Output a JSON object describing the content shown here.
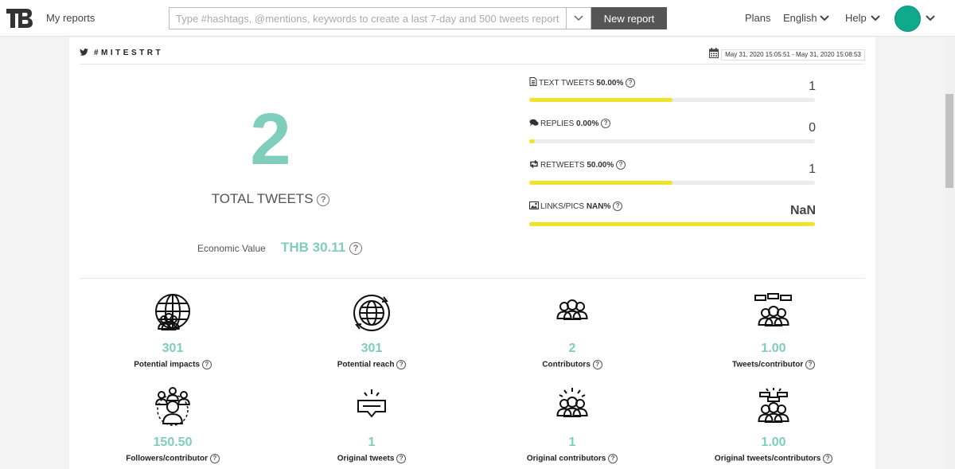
{
  "nav": {
    "my_reports": "My reports",
    "search_placeholder": "Type #hashtags, @mentions, keywords to create a last 7-day and 500 tweets report",
    "new_report": "New report",
    "plans": "Plans",
    "language": "English",
    "help": "Help"
  },
  "report": {
    "hashtag": "#MITESTRT",
    "date_range": "May 31, 2020 15:05:51 - May 31, 2020 15:08:53",
    "total_tweets": "2",
    "total_label": "TOTAL TWEETS",
    "economic_label": "Economic Value",
    "economic_value": "THB 30.11"
  },
  "metrics": [
    {
      "label": "TEXT TWEETS",
      "pct": "50.00%",
      "value": "1",
      "fill": 0.5,
      "icon": "document-icon"
    },
    {
      "label": "REPLIES",
      "pct": "0.00%",
      "value": "0",
      "fill": 0.02,
      "icon": "chat-bubble-icon"
    },
    {
      "label": "RETWEETS",
      "pct": "50.00%",
      "value": "1",
      "fill": 0.5,
      "icon": "retweet-icon"
    },
    {
      "label": "LINKS/PICS",
      "pct": "NAN%",
      "value": "NaN",
      "fill": 1.0,
      "icon": "image-icon"
    }
  ],
  "stats": [
    {
      "value": "301",
      "label": "Potential impacts",
      "icon": "globe-people-icon"
    },
    {
      "value": "301",
      "label": "Potential reach",
      "icon": "globe-reach-icon"
    },
    {
      "value": "2",
      "label": "Contributors",
      "icon": "group-icon"
    },
    {
      "value": "1.00",
      "label": "Tweets/contributor",
      "icon": "group-chat-icon"
    },
    {
      "value": "150.50",
      "label": "Followers/contributor",
      "icon": "network-people-icon"
    },
    {
      "value": "1",
      "label": "Original tweets",
      "icon": "message-icon"
    },
    {
      "value": "1",
      "label": "Original contributors",
      "icon": "group-spark-icon"
    },
    {
      "value": "1.00",
      "label": "Original tweets/contributors",
      "icon": "group-chat-spark-icon"
    }
  ],
  "colors": {
    "accent": "#7fcdbb",
    "bar": "#f0e42a",
    "avatar": "#10a98e"
  }
}
